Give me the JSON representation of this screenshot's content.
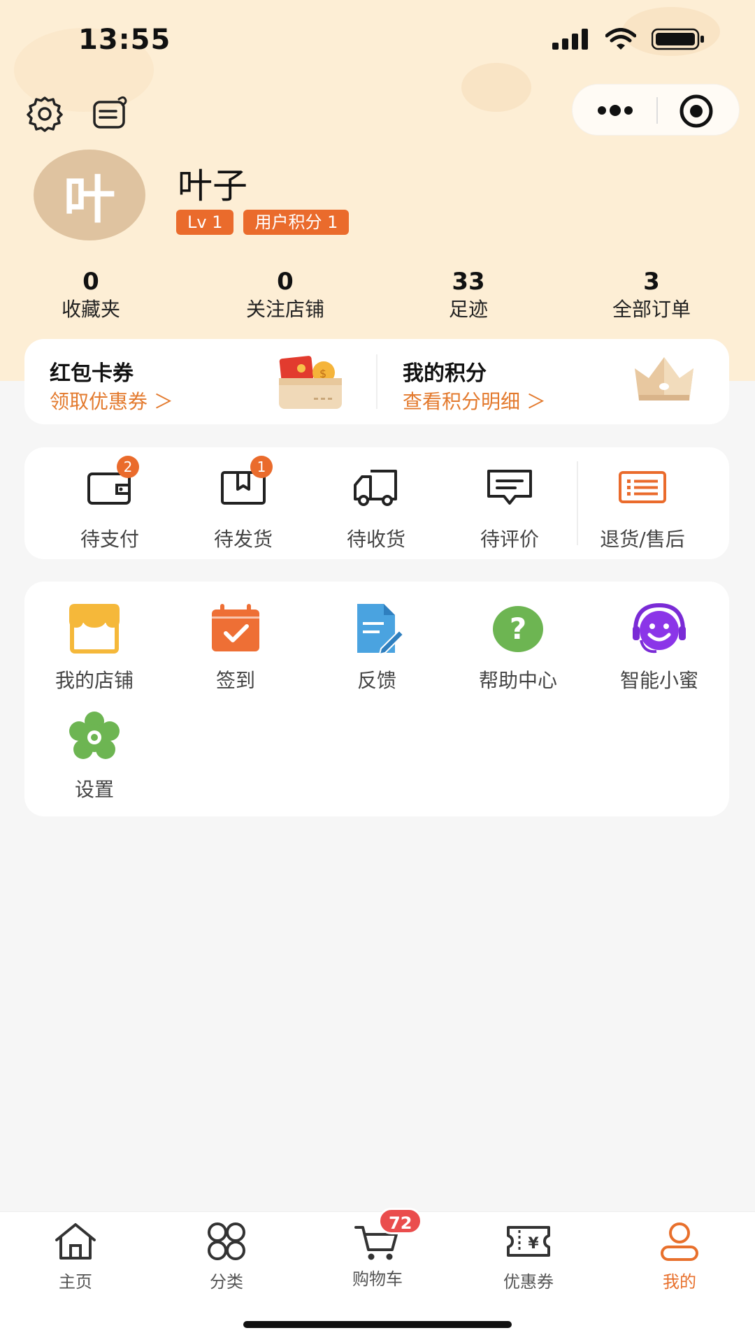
{
  "status": {
    "time": "13:55"
  },
  "colors": {
    "accent": "#ea6b2c",
    "hero_bg": "#fdeed5",
    "page_bg": "#f6f6f6",
    "cart_badge": "#ea4d4d"
  },
  "topbar": {
    "left_icons": [
      "gear-icon",
      "message-icon"
    ],
    "capsule_icons": [
      "more-dots-icon",
      "target-icon"
    ]
  },
  "profile": {
    "avatar_char": "叶",
    "name": "叶子",
    "level": "Lv 1",
    "points_badge": "用户积分 1"
  },
  "stats": [
    {
      "value": "0",
      "label": "收藏夹"
    },
    {
      "value": "0",
      "label": "关注店铺"
    },
    {
      "value": "33",
      "label": "足迹"
    },
    {
      "value": "3",
      "label": "全部订单"
    }
  ],
  "promo": {
    "coupons": {
      "title": "红包卡券",
      "link": "领取优惠券 ＞"
    },
    "points": {
      "title": "我的积分",
      "link": "查看积分明细 ＞"
    }
  },
  "orders": [
    {
      "label": "待支付",
      "icon": "wallet-icon",
      "count": "2"
    },
    {
      "label": "待发货",
      "icon": "package-icon",
      "count": "1"
    },
    {
      "label": "待收货",
      "icon": "truck-icon",
      "count": ""
    },
    {
      "label": "待评价",
      "icon": "comment-icon",
      "count": ""
    },
    {
      "label": "退货/售后",
      "icon": "return-list-icon",
      "count": ""
    }
  ],
  "tools": [
    {
      "label": "我的店铺",
      "icon": "store-icon"
    },
    {
      "label": "签到",
      "icon": "checkin-calendar-icon"
    },
    {
      "label": "反馈",
      "icon": "feedback-doc-icon"
    },
    {
      "label": "帮助中心",
      "icon": "help-icon"
    },
    {
      "label": "智能小蜜",
      "icon": "smiley-headset-icon"
    },
    {
      "label": "设置",
      "icon": "settings-flower-icon"
    }
  ],
  "tabbar": [
    {
      "label": "主页",
      "icon": "home-icon"
    },
    {
      "label": "分类",
      "icon": "category-icon"
    },
    {
      "label": "购物车",
      "icon": "cart-icon",
      "badge": "72"
    },
    {
      "label": "优惠券",
      "icon": "coupon-icon"
    },
    {
      "label": "我的",
      "icon": "profile-icon",
      "active": true
    }
  ]
}
